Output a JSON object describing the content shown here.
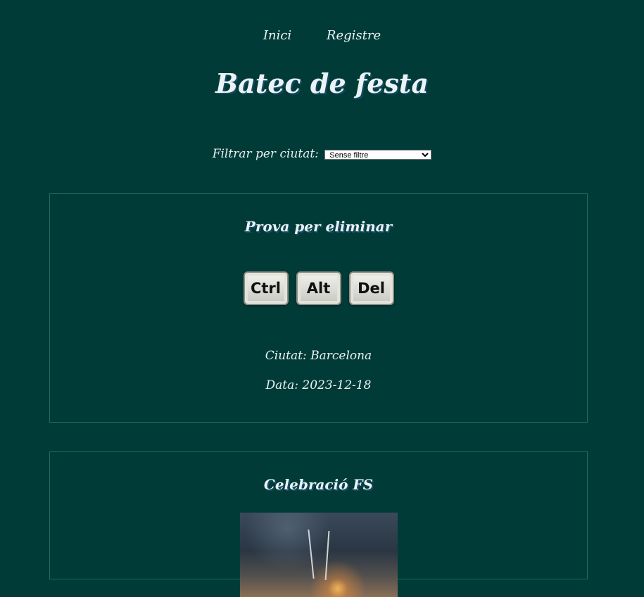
{
  "nav": {
    "home": "Inici",
    "register": "Registre"
  },
  "site": {
    "title": "Batec de festa"
  },
  "filter": {
    "label": "Filtrar per ciutat:",
    "selected": "Sense filtre"
  },
  "events": [
    {
      "title": "Prova per eliminar",
      "image_keys": [
        "Ctrl",
        "Alt",
        "Del"
      ],
      "city": "Ciutat: Barcelona",
      "date": "Data: 2023-12-18"
    },
    {
      "title": "Celebració FS",
      "image_icon": "sparkler-photo"
    }
  ],
  "colors": {
    "background": "#003b38",
    "card_border": "#1e6b66",
    "text": "#e8f3f2"
  }
}
